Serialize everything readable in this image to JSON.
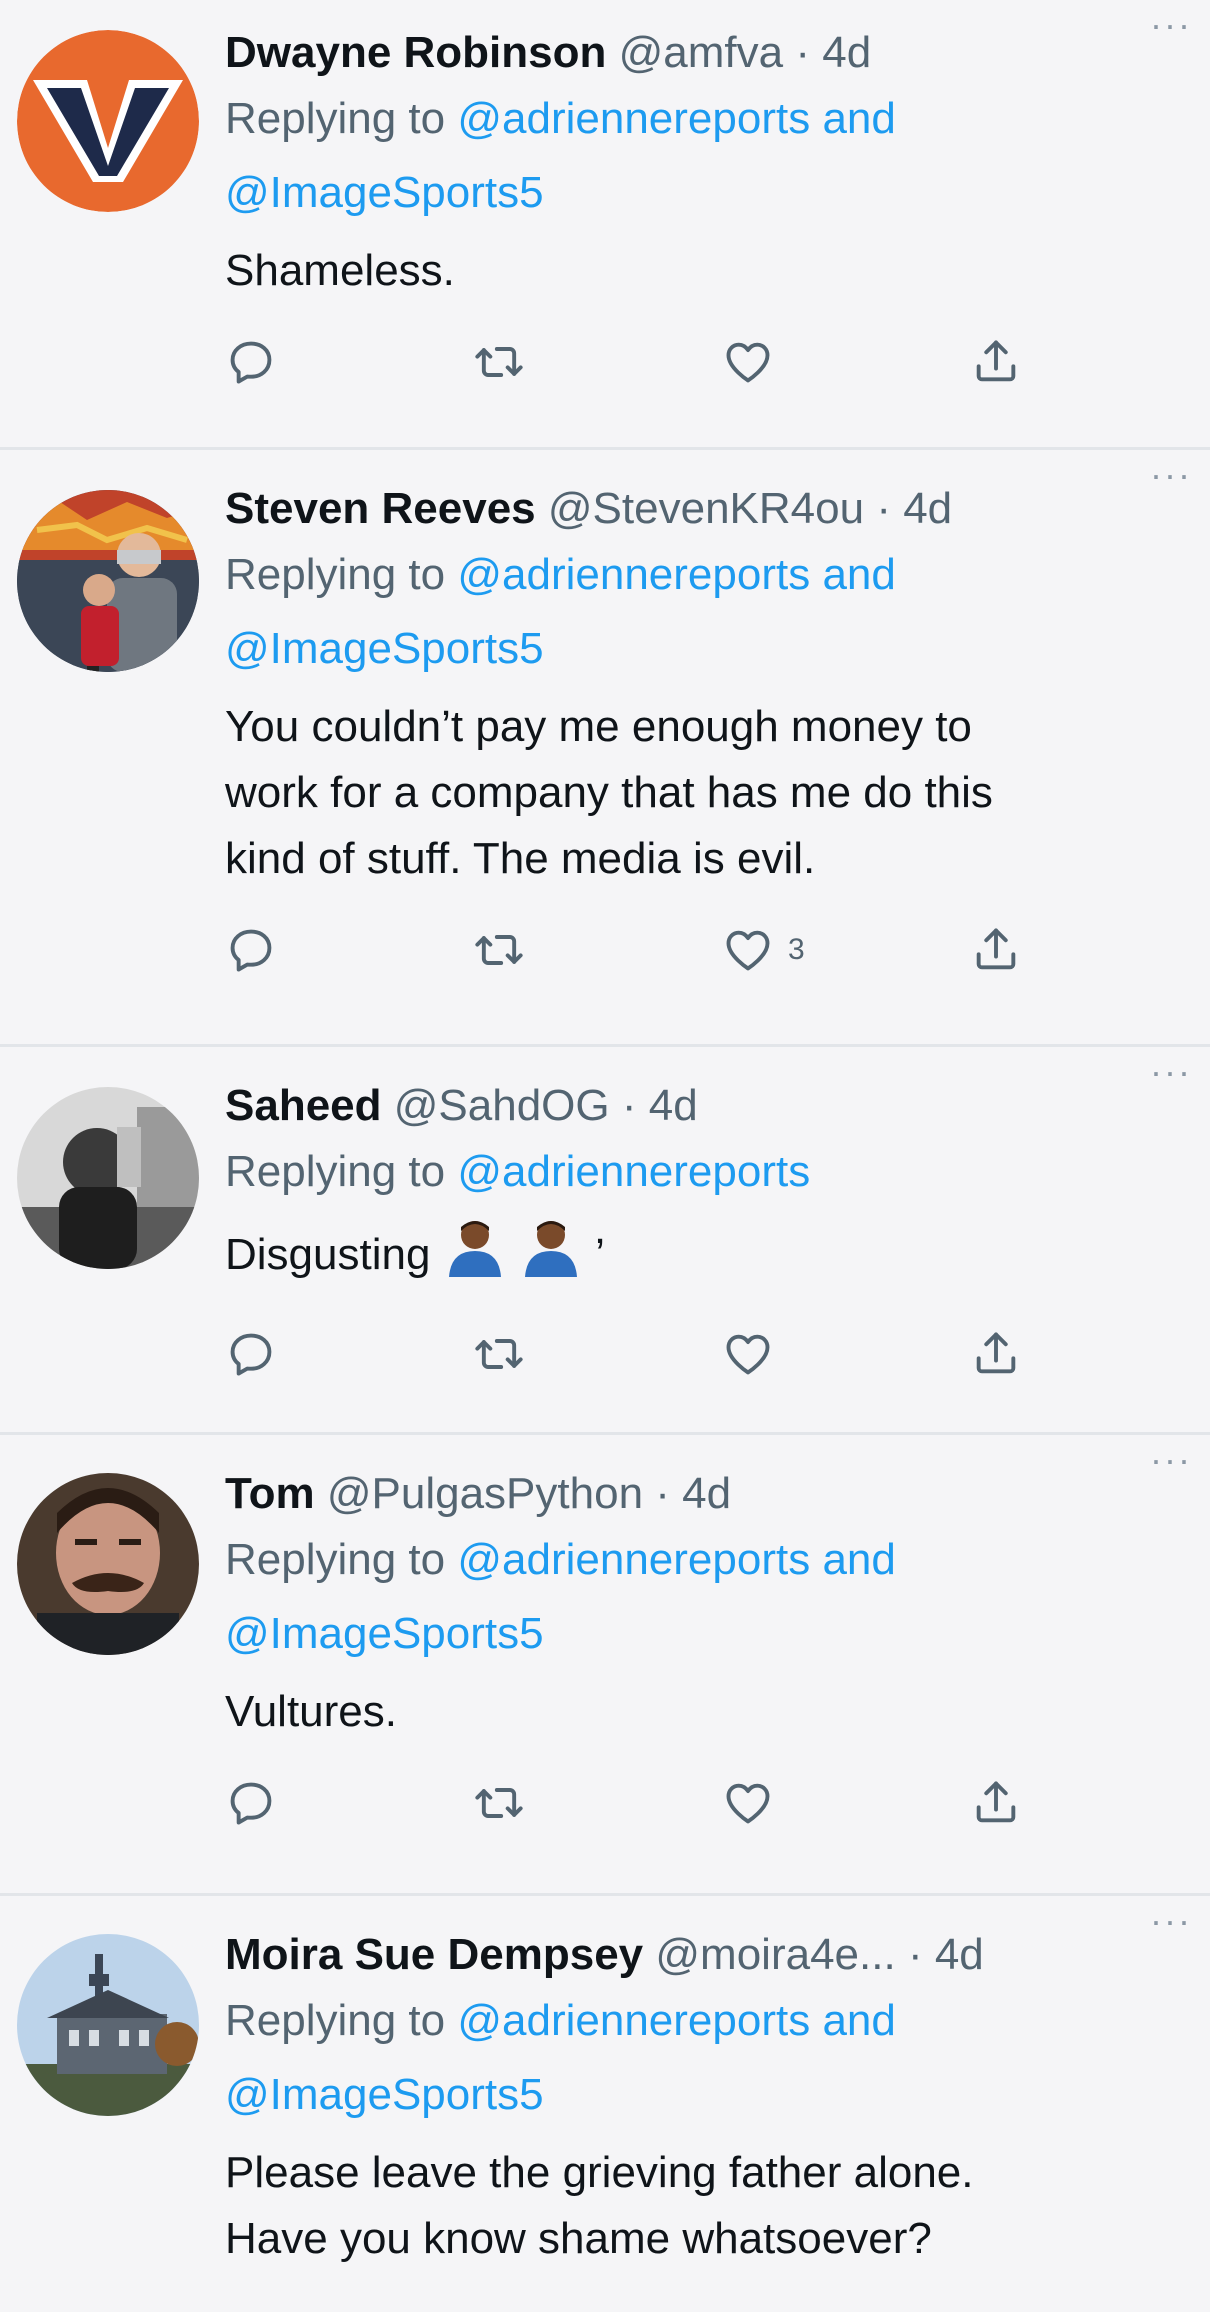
{
  "tweets": [
    {
      "name": "Dwayne Robinson",
      "handle": "@amfva",
      "sep": "·",
      "time": "4d",
      "replying_prefix": "Replying to ",
      "mention1": "@adriennereports",
      "and": " and",
      "mention2": "@ImageSports5",
      "text": "Shameless.",
      "likes": ""
    },
    {
      "name": "Steven Reeves",
      "handle": "@StevenKR4ou",
      "sep": "·",
      "time": "4d",
      "replying_prefix": "Replying to ",
      "mention1": "@adriennereports",
      "and": " and",
      "mention2": "@ImageSports5",
      "text_lines": [
        "You couldn’t pay me enough money to",
        "work for a company that has me do this",
        "kind of stuff. The media is evil."
      ],
      "likes": "3"
    },
    {
      "name": "Saheed",
      "handle": "@SahdOG",
      "sep": "·",
      "time": "4d",
      "replying_prefix": "Replying to ",
      "mention1": "@adriennereports",
      "text": "Disgusting",
      "text_suffix": "’",
      "likes": ""
    },
    {
      "name": "Tom",
      "handle": "@PulgasPython",
      "sep": "·",
      "time": "4d",
      "replying_prefix": "Replying to ",
      "mention1": "@adriennereports",
      "and": " and",
      "mention2": "@ImageSports5",
      "text": "Vultures.",
      "likes": ""
    },
    {
      "name": "Moira Sue Dempsey",
      "handle": "@moira4e...",
      "sep": "·",
      "time": "4d",
      "replying_prefix": "Replying to ",
      "mention1": "@adriennereports",
      "and": " and",
      "mention2": "@ImageSports5",
      "text_lines": [
        "Please leave the grieving father alone.",
        "Have you know shame whatsoever?"
      ]
    }
  ],
  "more_label": "···",
  "icons": {
    "reply": "reply-icon",
    "retweet": "retweet-icon",
    "like": "like-icon",
    "share": "share-icon"
  },
  "colors": {
    "accent": "#1d9bf0",
    "secondary_text": "#536471",
    "background": "#f5f5f7"
  }
}
